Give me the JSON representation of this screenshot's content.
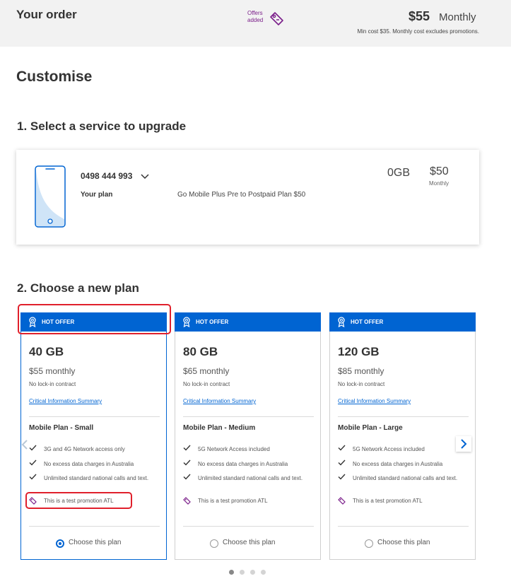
{
  "header": {
    "title": "Your order",
    "offers_line1": "Offers",
    "offers_line2": "added",
    "offers_icon": "tag-icon",
    "price": "$55",
    "price_period": "Monthly",
    "min_cost_note": "Min cost $35. Monthly cost excludes promotions."
  },
  "page": {
    "heading": "Customise"
  },
  "service_section": {
    "heading": "1. Select a service to upgrade",
    "phone_number": "0498 444 993",
    "plan_label": "Your plan",
    "plan_value": "Go Mobile Plus Pre to Postpaid Plan $50",
    "data": "0GB",
    "price": "$50",
    "price_period": "Monthly",
    "icons": [
      "phone-icon",
      "chevron-down-icon"
    ]
  },
  "plan_section": {
    "heading": "2. Choose a new plan",
    "plans": [
      {
        "badge": "HOT OFFER",
        "data": "40 GB",
        "price": "$55 monthly",
        "contract": "No lock-in contract",
        "cis_link": "Critical Information Summary",
        "name": "Mobile Plan - Small",
        "features": [
          "3G and 4G Network access only",
          "No excess data charges in Australia",
          "Unlimited standard national calls and text."
        ],
        "promo": "This is a test promotion ATL",
        "choose_label": "Choose this plan",
        "selected": true
      },
      {
        "badge": "HOT OFFER",
        "data": "80 GB",
        "price": "$65 monthly",
        "contract": "No lock-in contract",
        "cis_link": "Critical Information Summary",
        "name": "Mobile Plan - Medium",
        "features": [
          "5G Network Access included",
          "No excess data charges in Australia",
          "Unlimited standard national calls and text."
        ],
        "promo": "This is a test promotion ATL",
        "choose_label": "Choose this plan",
        "selected": false
      },
      {
        "badge": "HOT OFFER",
        "data": "120 GB",
        "price": "$85 monthly",
        "contract": "No lock-in contract",
        "cis_link": "Critical Information Summary",
        "name": "Mobile Plan - Large",
        "features": [
          "5G Network Access included",
          "No excess data charges in Australia",
          "Unlimited standard national calls and text."
        ],
        "promo": "This is a test promotion ATL",
        "choose_label": "Choose this plan",
        "selected": false
      }
    ],
    "carousel": {
      "pages": 4,
      "active_page": 1
    }
  },
  "colors": {
    "brand_blue": "#0064d2",
    "promo_purple": "#7b1f8a",
    "highlight_red": "#e0202c",
    "header_bg": "#f2f2f2"
  }
}
